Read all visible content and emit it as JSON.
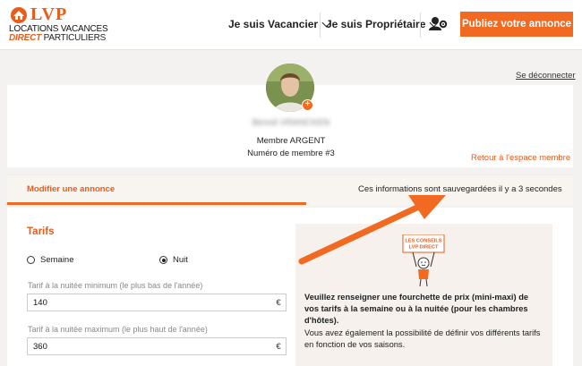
{
  "brand": {
    "logo_text": "LVP",
    "line1": "LOCATIONS VACANCES",
    "line2_highlight": "DIRECT",
    "line2_rest": "PARTICULIERS",
    "accent_color": "#f26a21"
  },
  "nav": {
    "vacancier": "Je suis Vacancier",
    "proprietaire": "Je suis Propriétaire",
    "account_icon": "user-gear-icon",
    "cta": "Publiez votre annonce"
  },
  "account": {
    "logout": "Se déconnecter",
    "name": "Benoit VRANCKEN",
    "level": "Membre ARGENT",
    "member_number": "Numéro de membre #3",
    "back_link": "Retour à l'espace membre"
  },
  "tabs": {
    "active": "Modifier une annonce",
    "save_status": "Ces informations sont sauvegardées il y a 3 secondes"
  },
  "tarifs": {
    "title": "Tarifs",
    "options": [
      {
        "label": "Semaine",
        "selected": false
      },
      {
        "label": "Nuit",
        "selected": true
      }
    ],
    "min_label": "Tarif à la nuitée minimum (le plus bas de l'année)",
    "min_value": "140",
    "max_label": "Tarif à la nuitée maximum (le plus haut de l'année)",
    "max_value": "360",
    "currency": "€"
  },
  "advice": {
    "badge_line1": "LES CONSEILS",
    "badge_line2": "LVP DIRECT",
    "paragraph1": "Veuillez renseigner une fourchette de prix (mini-maxi) de vos tarifs à la semaine ou à la nuitée (pour les chambres d'hôtes).",
    "paragraph2": "Vous avez également la possibilité de définir vos différents tarifs en fonction de vos saisons."
  }
}
